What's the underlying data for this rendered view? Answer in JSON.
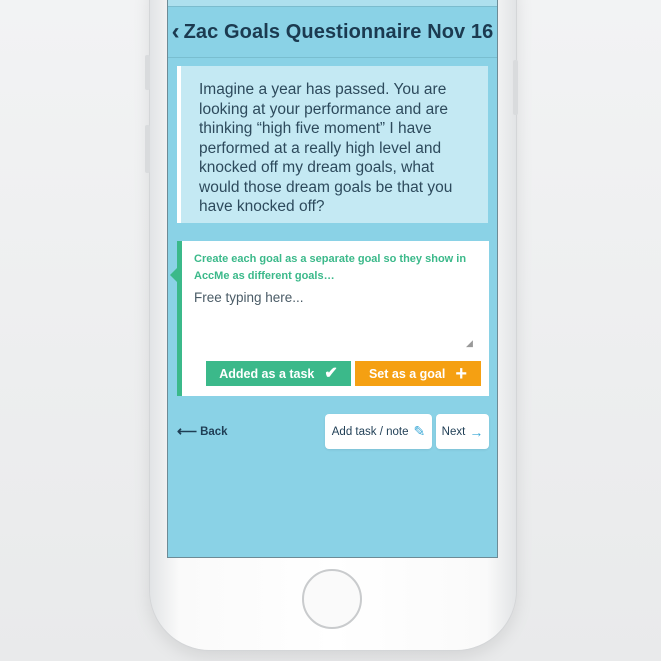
{
  "header": {
    "back_icon": "chevron-left-icon",
    "title": "Zac Goals Questionnaire Nov 16"
  },
  "question": {
    "text": "Imagine a year has passed. You are looking at your performance and are thinking “high five moment” I have performed at a really high level and knocked off my dream goals, what would those dream goals be that you have knocked off?"
  },
  "answer": {
    "hint": "Create each goal as a separate goal so they show in AccMe as different goals…",
    "placeholder": "Free typing here...",
    "value": ""
  },
  "actions": {
    "task_label": "Added as a task",
    "task_icon": "check-icon",
    "goal_label": "Set as a goal",
    "goal_icon": "plus-icon"
  },
  "nav": {
    "back_label": "Back",
    "note_label": "Add task / note",
    "note_icon": "pencil-icon",
    "next_label": "Next",
    "next_icon": "arrow-right-icon"
  },
  "colors": {
    "screen_bg": "#8ad2e6",
    "question_bg": "#c4e9f3",
    "accent_green": "#3bb98a",
    "accent_orange": "#f5a012",
    "title_text": "#1b3a50",
    "link_blue": "#38a7d6"
  }
}
